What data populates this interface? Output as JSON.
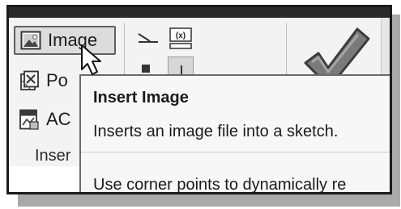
{
  "ribbon": {
    "insert_panel": {
      "buttons": [
        {
          "label": "Image",
          "icon": "image-icon"
        },
        {
          "label": "Po",
          "icon": "points-icon"
        },
        {
          "label": "AC",
          "icon": "acad-icon"
        }
      ],
      "panel_label": "Inser"
    },
    "tools": [
      {
        "icon": "line-constraint-icon"
      },
      {
        "icon": "parameter-icon",
        "glyph": "[(x)]"
      }
    ],
    "finish_icon": "checkmark-icon"
  },
  "tooltip": {
    "title": "Insert Image",
    "description": "Inserts an image file into a sketch.",
    "detail": "Use corner points to dynamically re"
  }
}
